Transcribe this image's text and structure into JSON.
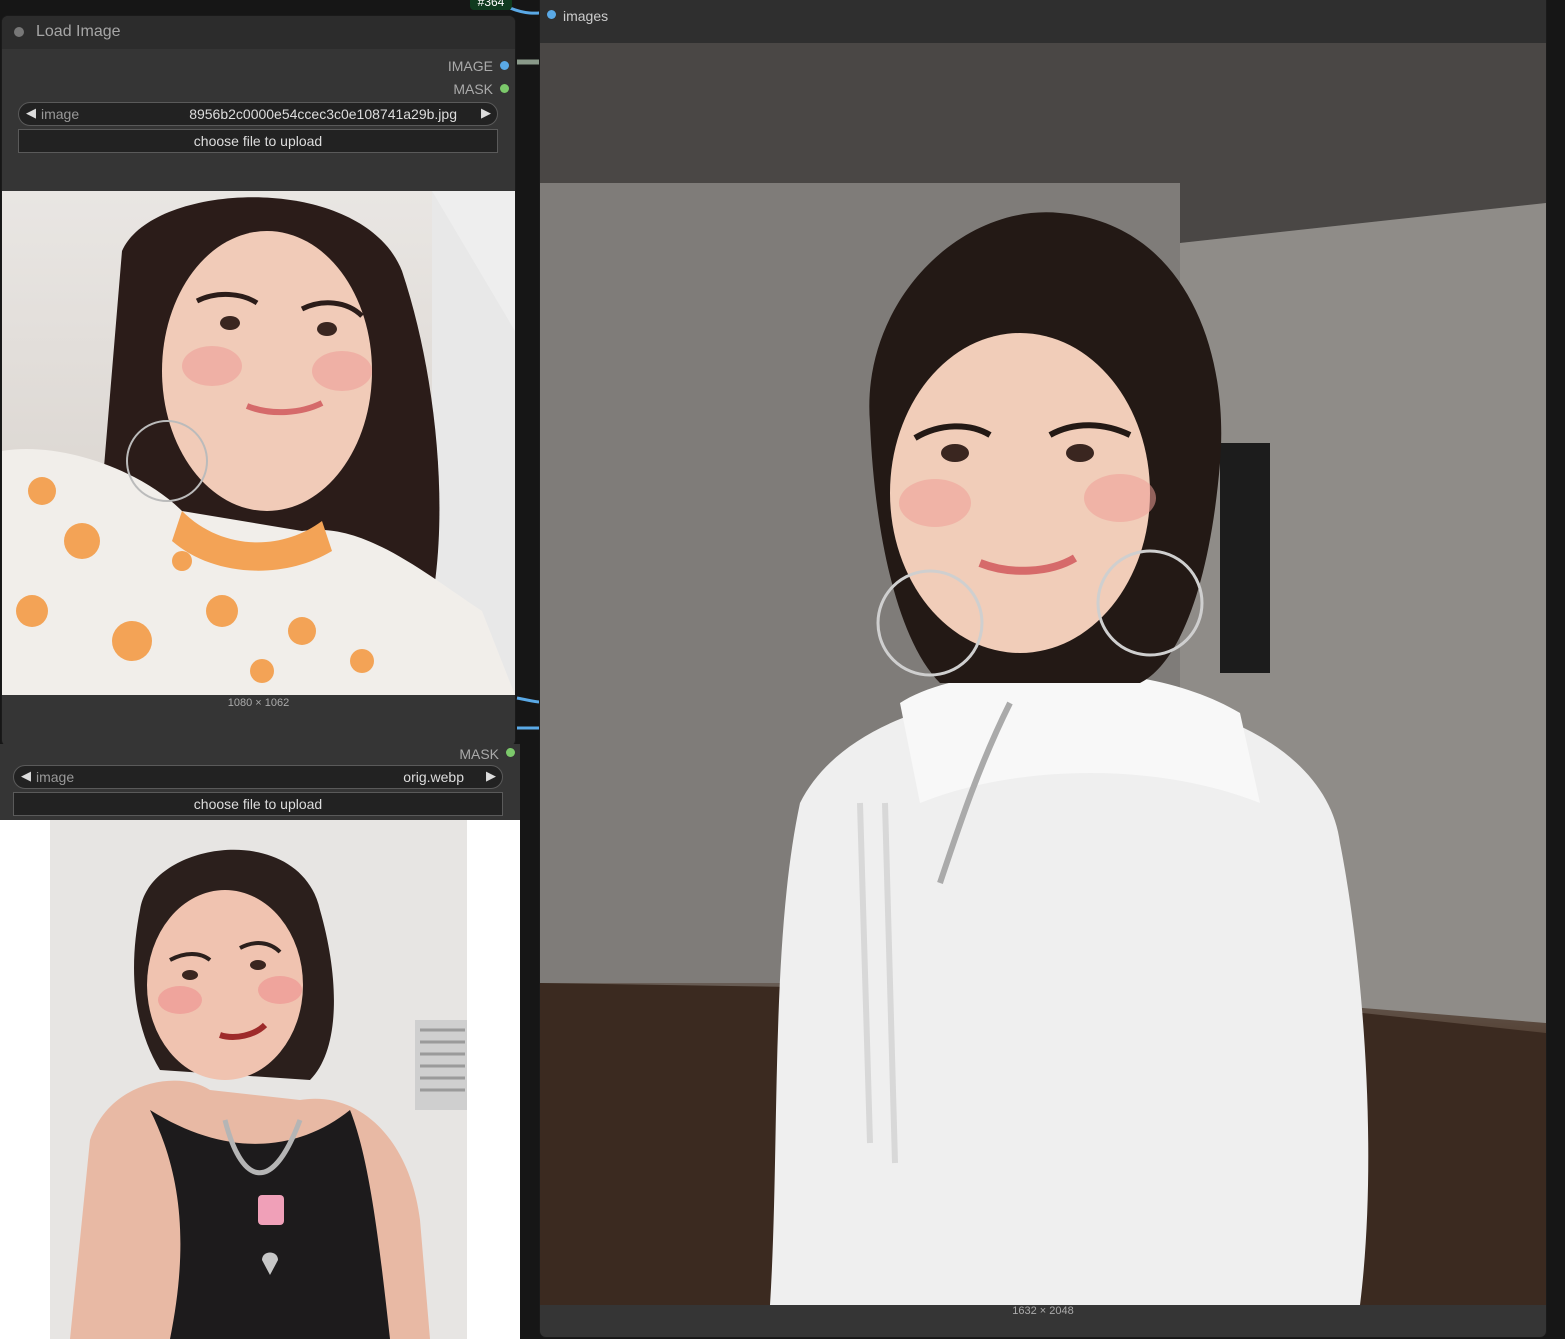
{
  "canvas": {
    "node_badge": "#364"
  },
  "load_image_node": {
    "title": "Load Image",
    "outputs": [
      {
        "label": "IMAGE",
        "color": "#5aa9e6"
      },
      {
        "label": "MASK",
        "color": "#7cc96b"
      }
    ],
    "image_widget": {
      "name": "image",
      "value": "8956b2c0000e54ccec3c0e108741a29b.jpg"
    },
    "upload_label": "choose file to upload",
    "preview_dims": "1080 × 1062"
  },
  "second_node": {
    "outputs": [
      {
        "label": "MASK",
        "color": "#7cc96b"
      }
    ],
    "image_widget": {
      "name": "image",
      "value": "orig.webp"
    },
    "upload_label": "choose file to upload"
  },
  "preview_node": {
    "input_label": "images",
    "input_color": "#5aa9e6",
    "preview_dims": "1632 × 2048"
  },
  "icons": {
    "left_arrow": "◀",
    "right_arrow": "▶"
  }
}
